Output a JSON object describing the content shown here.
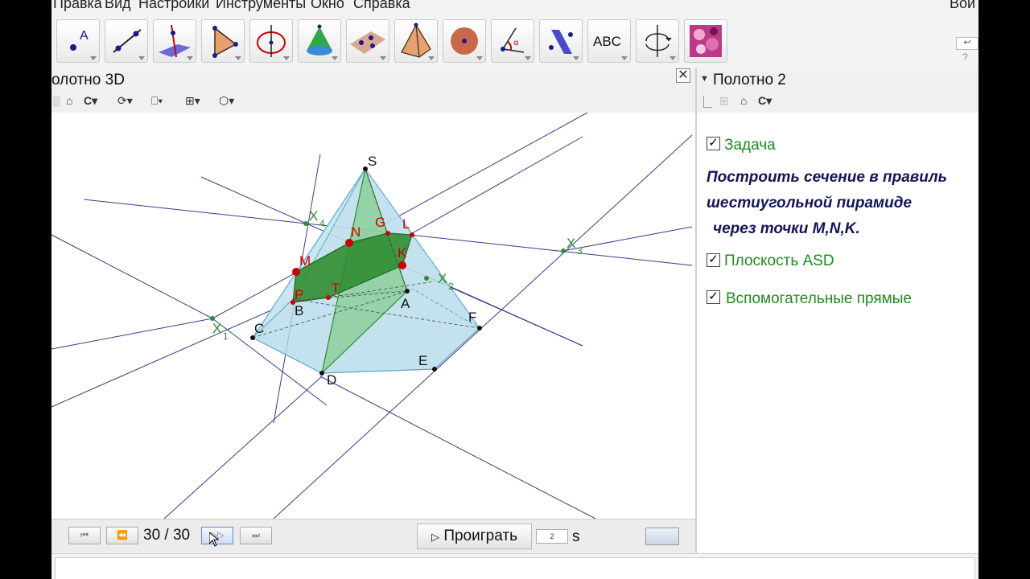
{
  "menu": {
    "items": [
      "Правка",
      "Вид",
      "Настройки",
      "Инструменты",
      "Окно",
      "Справка"
    ],
    "sign_in": "Вой"
  },
  "toolbar": {
    "tools": [
      {
        "name": "point-tool",
        "glyph": "A"
      },
      {
        "name": "line-tool",
        "glyph": ""
      },
      {
        "name": "perpendicular-tool",
        "glyph": ""
      },
      {
        "name": "polygon-tool",
        "glyph": ""
      },
      {
        "name": "circle-tool",
        "glyph": ""
      },
      {
        "name": "cone-tool",
        "glyph": ""
      },
      {
        "name": "net-tool",
        "glyph": ""
      },
      {
        "name": "pyramid-tool",
        "glyph": ""
      },
      {
        "name": "sphere-tool",
        "glyph": ""
      },
      {
        "name": "angle-tool",
        "glyph": ""
      },
      {
        "name": "reflect-tool",
        "glyph": ""
      },
      {
        "name": "text-tool",
        "glyph": "ABC"
      },
      {
        "name": "rotate-view-tool",
        "glyph": ""
      },
      {
        "name": "image-tool",
        "glyph": ""
      }
    ],
    "undo_symbol": "↩",
    "help_symbol": "?"
  },
  "view3d": {
    "title": "олотно 3D",
    "close_symbol": "✕",
    "labels": {
      "S": "S",
      "N": "N",
      "G": "G",
      "L": "L",
      "K": "K",
      "M": "M",
      "P": "P",
      "T": "T",
      "B": "B",
      "A": "A",
      "C": "C",
      "D": "D",
      "E": "E",
      "F": "F",
      "X4": "X",
      "X4_sub": "4",
      "X3": "X",
      "X3_sub": "3",
      "X2": "X",
      "X2_sub": "2",
      "X1": "X",
      "X1_sub": "1"
    }
  },
  "animation": {
    "frame": "30 / 30",
    "play_label": "Проиграть",
    "play_icon": "▷",
    "speed": "2",
    "speed_unit": "s",
    "first_symbol": "⏮",
    "prev_symbol": "⏪",
    "next_symbol": "▷▷",
    "last_symbol": "⏭"
  },
  "panel2": {
    "title": "Полотно 2",
    "items": [
      {
        "label": "Задача",
        "checked": true
      },
      {
        "label": "Плоскость ASD",
        "checked": true
      },
      {
        "label": "Вспомогательные прямые",
        "checked": true
      }
    ],
    "task_lines": [
      "Построить сечение в правиль",
      "шестиугольной пирамиде",
      "через точки M,N,K."
    ],
    "check_symbol": "✓"
  },
  "colors": {
    "pyramid_fill": "#b5dbe9",
    "section_fill": "#2e8b2e",
    "plane_fill": "#6fc46f",
    "aux_line": "#3a3a8a",
    "label_green": "#1e8a1e",
    "label_red": "#c00000"
  }
}
